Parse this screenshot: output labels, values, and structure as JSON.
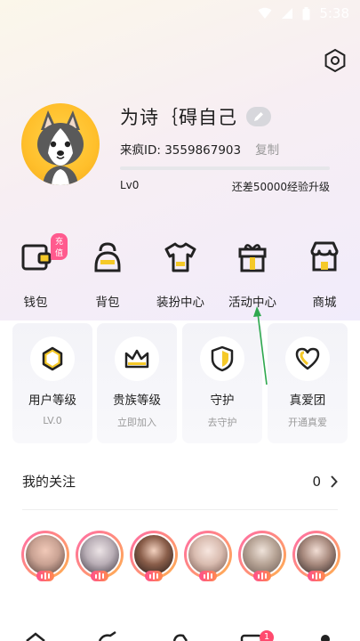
{
  "status_bar": {
    "time": "5:38"
  },
  "profile": {
    "username": "为诗｛碍自己",
    "id_label": "来疯ID: 3559867903",
    "copy_label": "复制",
    "level": "Lv0",
    "upgrade_hint": "还差50000经验升级",
    "progress_fraction": 0.0
  },
  "quick_actions": [
    {
      "label": "钱包",
      "icon": "wallet-icon",
      "badge": "充值"
    },
    {
      "label": "背包",
      "icon": "backpack-icon"
    },
    {
      "label": "装扮中心",
      "icon": "shirt-icon"
    },
    {
      "label": "活动中心",
      "icon": "gift-box-icon"
    },
    {
      "label": "商城",
      "icon": "shop-icon"
    }
  ],
  "cards": [
    {
      "title": "用户等级",
      "sub": "LV.0",
      "icon": "hexagon-icon"
    },
    {
      "title": "贵族等级",
      "sub": "立即加入",
      "icon": "crown-icon"
    },
    {
      "title": "守护",
      "sub": "去守护",
      "icon": "shield-icon"
    },
    {
      "title": "真爱团",
      "sub": "开通真爱",
      "icon": "heart-icon"
    }
  ],
  "follow": {
    "title": "我的关注",
    "count": "0"
  },
  "tab_badge": "1",
  "colors": {
    "accent_yellow": "#f5c928",
    "live_pink": "#ff4f8b",
    "arrow_green": "#2fa84f"
  }
}
